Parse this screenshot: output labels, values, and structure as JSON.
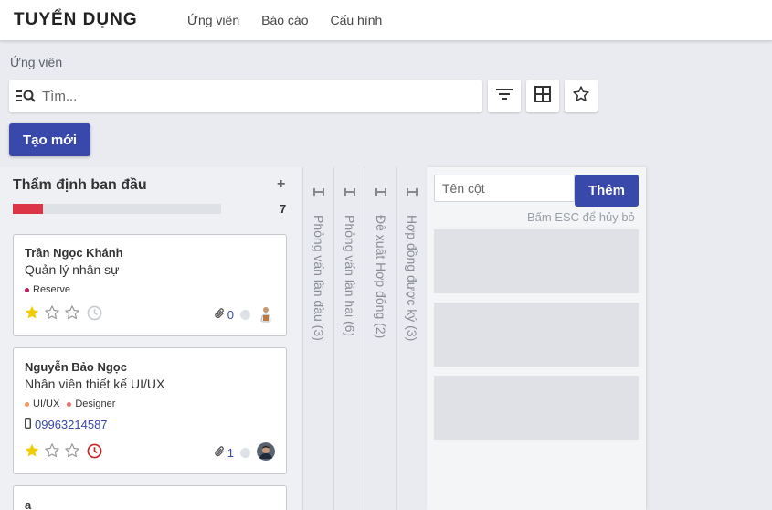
{
  "app": {
    "title": "TUYỂN DỤNG",
    "menu": [
      "Ứng viên",
      "Báo cáo",
      "Cấu hình"
    ]
  },
  "control_panel": {
    "breadcrumb": "Ứng viên",
    "search_placeholder": "Tìm...",
    "create_label": "Tạo mới",
    "icons": [
      "filter-icon",
      "group-by-icon",
      "favorite-star-icon"
    ]
  },
  "kanban": {
    "column": {
      "title": "Thẩm định ban đầu",
      "add_symbol": "+",
      "count": "7",
      "progress_red_fraction": 0.145,
      "cards": [
        {
          "name": "Trần Ngọc Khánh",
          "job": "Quản lý nhân sự",
          "tags": [
            {
              "label": "Reserve",
              "color": "#c2185b"
            }
          ],
          "priority_stars": 1,
          "attachments": "0",
          "activity": "clock-gray"
        },
        {
          "name": "Nguyễn Bảo Ngọc",
          "job": "Nhân viên thiết kế UI/UX",
          "tags": [
            {
              "label": "UI/UX",
              "color": "#f0965a"
            },
            {
              "label": "Designer",
              "color": "#e57373"
            }
          ],
          "phone": "09963214587",
          "priority_stars": 1,
          "attachments": "1",
          "activity": "clock-red"
        },
        {
          "name": "a"
        }
      ]
    },
    "folded_columns": [
      "Phỏng vấn lần đầu (3)",
      "Phỏng vấn lần hai (6)",
      "Đề xuất Hợp đồng (2)",
      "Hợp đồng được ký (3)"
    ],
    "quick_create": {
      "placeholder": "Tên cột",
      "add_label": "Thêm",
      "hint": "Bấm ESC để hủy bỏ"
    }
  },
  "colors": {
    "primary": "#3949ab",
    "danger": "#dc3545",
    "star": "#f3cc00"
  }
}
